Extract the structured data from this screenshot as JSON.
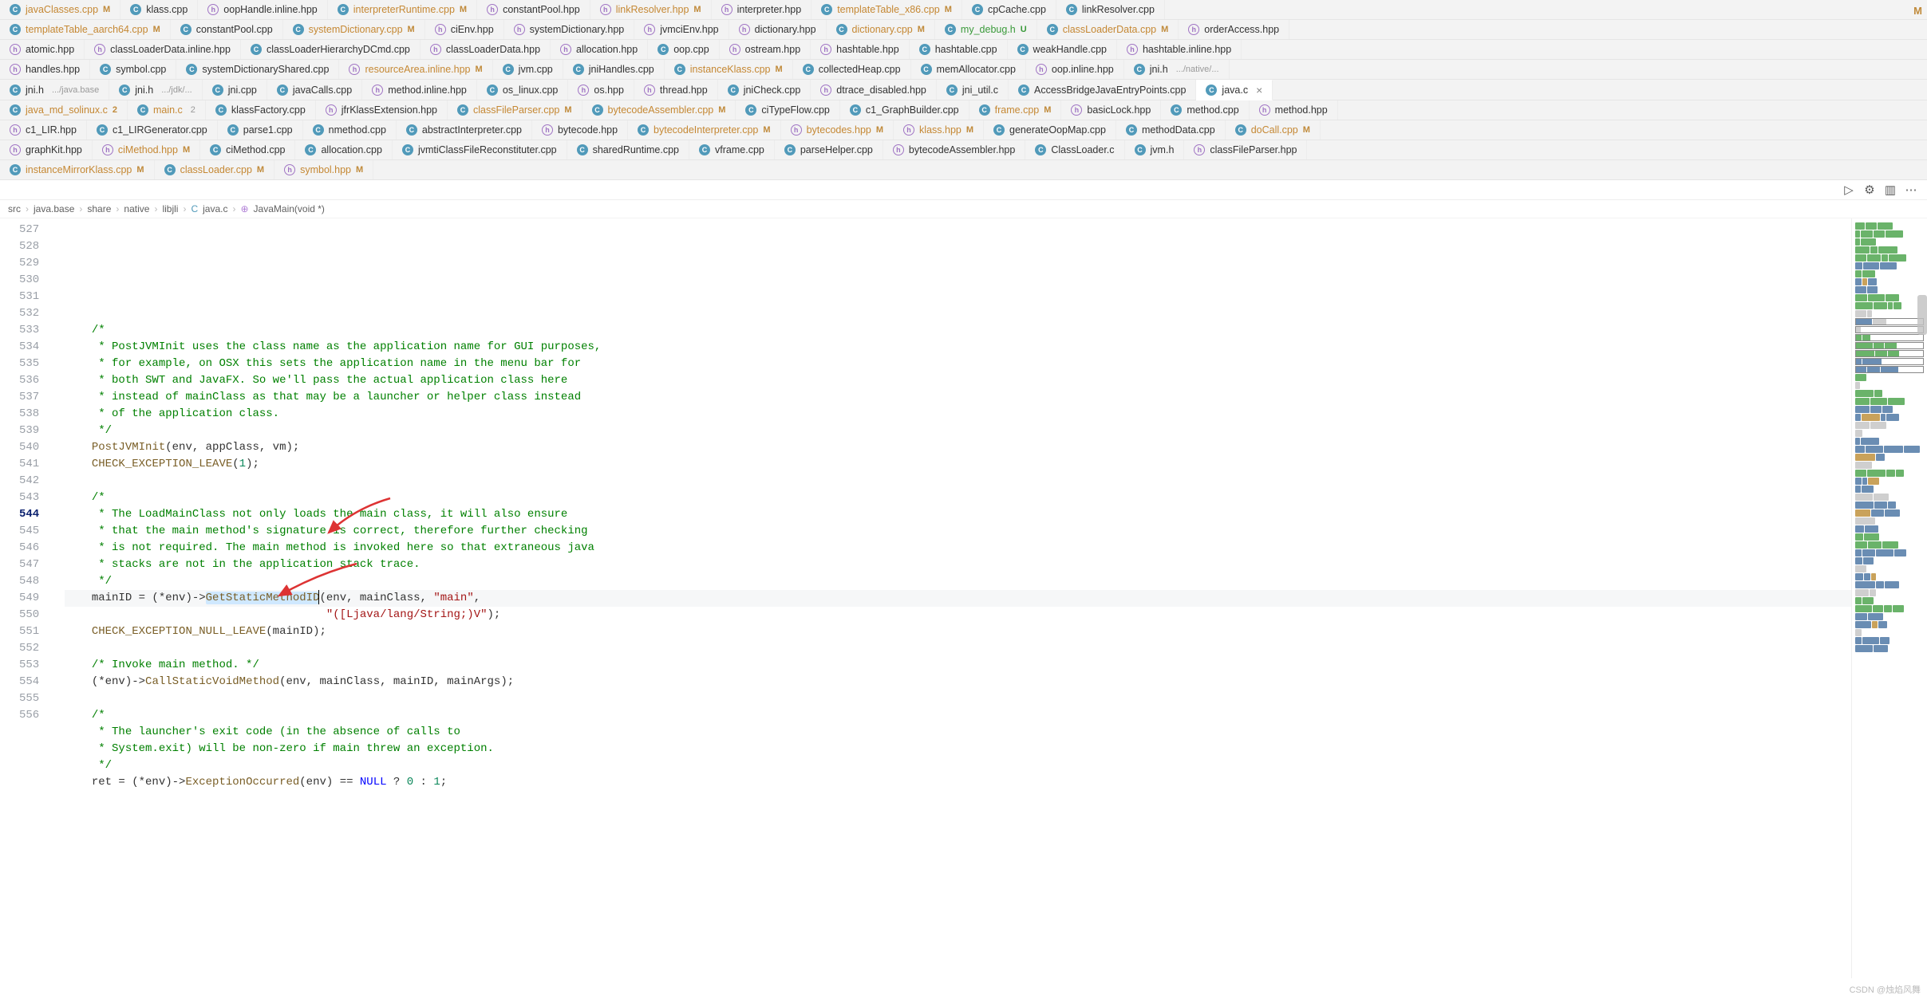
{
  "tab_rows": [
    [
      {
        "icon": "c",
        "name": "javaClasses.cpp",
        "mod": "M",
        "cls": "orange"
      },
      {
        "icon": "c",
        "name": "klass.cpp",
        "cls": "gray"
      },
      {
        "icon": "h",
        "name": "oopHandle.inline.hpp",
        "cls": "gray"
      },
      {
        "icon": "c",
        "name": "interpreterRuntime.cpp",
        "mod": "M",
        "cls": "orange"
      },
      {
        "icon": "h",
        "name": "constantPool.hpp",
        "cls": "gray"
      },
      {
        "icon": "h",
        "name": "linkResolver.hpp",
        "mod": "M",
        "cls": "orange"
      },
      {
        "icon": "h",
        "name": "interpreter.hpp",
        "cls": "gray"
      },
      {
        "icon": "c",
        "name": "templateTable_x86.cpp",
        "mod": "M",
        "cls": "orange"
      },
      {
        "icon": "c",
        "name": "cpCache.cpp",
        "cls": "gray"
      },
      {
        "icon": "c",
        "name": "linkResolver.cpp",
        "cls": "gray"
      }
    ],
    [
      {
        "icon": "c",
        "name": "templateTable_aarch64.cpp",
        "mod": "M",
        "cls": "orange"
      },
      {
        "icon": "c",
        "name": "constantPool.cpp",
        "cls": "gray"
      },
      {
        "icon": "c",
        "name": "systemDictionary.cpp",
        "mod": "M",
        "cls": "orange"
      },
      {
        "icon": "h",
        "name": "ciEnv.hpp",
        "cls": "gray"
      },
      {
        "icon": "h",
        "name": "systemDictionary.hpp",
        "cls": "gray"
      },
      {
        "icon": "h",
        "name": "jvmciEnv.hpp",
        "cls": "gray"
      },
      {
        "icon": "h",
        "name": "dictionary.hpp",
        "cls": "gray"
      },
      {
        "icon": "c",
        "name": "dictionary.cpp",
        "mod": "M",
        "cls": "orange"
      },
      {
        "icon": "c",
        "name": "my_debug.h",
        "mod": "U",
        "cls": "green"
      },
      {
        "icon": "c",
        "name": "classLoaderData.cpp",
        "mod": "M",
        "cls": "orange"
      },
      {
        "icon": "h",
        "name": "orderAccess.hpp",
        "cls": "gray"
      }
    ],
    [
      {
        "icon": "h",
        "name": "atomic.hpp",
        "cls": "gray"
      },
      {
        "icon": "h",
        "name": "classLoaderData.inline.hpp",
        "cls": "gray"
      },
      {
        "icon": "c",
        "name": "classLoaderHierarchyDCmd.cpp",
        "cls": "gray"
      },
      {
        "icon": "h",
        "name": "classLoaderData.hpp",
        "cls": "gray"
      },
      {
        "icon": "h",
        "name": "allocation.hpp",
        "cls": "gray"
      },
      {
        "icon": "c",
        "name": "oop.cpp",
        "cls": "gray"
      },
      {
        "icon": "h",
        "name": "ostream.hpp",
        "cls": "gray"
      },
      {
        "icon": "h",
        "name": "hashtable.hpp",
        "cls": "gray"
      },
      {
        "icon": "c",
        "name": "hashtable.cpp",
        "cls": "gray"
      },
      {
        "icon": "c",
        "name": "weakHandle.cpp",
        "cls": "gray"
      },
      {
        "icon": "h",
        "name": "hashtable.inline.hpp",
        "cls": "gray"
      }
    ],
    [
      {
        "icon": "h",
        "name": "handles.hpp",
        "cls": "gray"
      },
      {
        "icon": "c",
        "name": "symbol.cpp",
        "cls": "gray"
      },
      {
        "icon": "c",
        "name": "systemDictionaryShared.cpp",
        "cls": "gray"
      },
      {
        "icon": "h",
        "name": "resourceArea.inline.hpp",
        "mod": "M",
        "cls": "orange"
      },
      {
        "icon": "c",
        "name": "jvm.cpp",
        "cls": "gray"
      },
      {
        "icon": "c",
        "name": "jniHandles.cpp",
        "cls": "gray"
      },
      {
        "icon": "c",
        "name": "instanceKlass.cpp",
        "mod": "M",
        "cls": "orange"
      },
      {
        "icon": "c",
        "name": "collectedHeap.cpp",
        "cls": "gray"
      },
      {
        "icon": "c",
        "name": "memAllocator.cpp",
        "cls": "gray"
      },
      {
        "icon": "h",
        "name": "oop.inline.hpp",
        "cls": "gray"
      },
      {
        "icon": "c",
        "name": "jni.h",
        "sub": ".../native/...",
        "cls": "gray"
      }
    ],
    [
      {
        "icon": "c",
        "name": "jni.h",
        "sub": ".../java.base",
        "cls": "gray"
      },
      {
        "icon": "c",
        "name": "jni.h",
        "sub": ".../jdk/...",
        "cls": "gray"
      },
      {
        "icon": "c",
        "name": "jni.cpp",
        "cls": "gray"
      },
      {
        "icon": "c",
        "name": "javaCalls.cpp",
        "cls": "gray"
      },
      {
        "icon": "h",
        "name": "method.inline.hpp",
        "cls": "gray"
      },
      {
        "icon": "c",
        "name": "os_linux.cpp",
        "cls": "gray"
      },
      {
        "icon": "h",
        "name": "os.hpp",
        "cls": "gray"
      },
      {
        "icon": "h",
        "name": "thread.hpp",
        "cls": "gray"
      },
      {
        "icon": "c",
        "name": "jniCheck.cpp",
        "cls": "gray"
      },
      {
        "icon": "h",
        "name": "dtrace_disabled.hpp",
        "cls": "gray"
      },
      {
        "icon": "c",
        "name": "jni_util.c",
        "cls": "gray"
      },
      {
        "icon": "c",
        "name": "AccessBridgeJavaEntryPoints.cpp",
        "cls": "gray"
      },
      {
        "icon": "c",
        "name": "java.c",
        "cls": "gray",
        "active": true,
        "close": true
      }
    ],
    [
      {
        "icon": "c",
        "name": "java_md_solinux.c",
        "mod": "2",
        "cls": "orange"
      },
      {
        "icon": "c",
        "name": "main.c",
        "sub": "2",
        "cls": "orange"
      },
      {
        "icon": "c",
        "name": "klassFactory.cpp",
        "cls": "gray"
      },
      {
        "icon": "h",
        "name": "jfrKlassExtension.hpp",
        "cls": "gray"
      },
      {
        "icon": "c",
        "name": "classFileParser.cpp",
        "mod": "M",
        "cls": "orange"
      },
      {
        "icon": "c",
        "name": "bytecodeAssembler.cpp",
        "mod": "M",
        "cls": "orange"
      },
      {
        "icon": "c",
        "name": "ciTypeFlow.cpp",
        "cls": "gray"
      },
      {
        "icon": "c",
        "name": "c1_GraphBuilder.cpp",
        "cls": "gray"
      },
      {
        "icon": "c",
        "name": "frame.cpp",
        "mod": "M",
        "cls": "orange"
      },
      {
        "icon": "h",
        "name": "basicLock.hpp",
        "cls": "gray"
      },
      {
        "icon": "c",
        "name": "method.cpp",
        "cls": "gray"
      },
      {
        "icon": "h",
        "name": "method.hpp",
        "cls": "gray"
      }
    ],
    [
      {
        "icon": "h",
        "name": "c1_LIR.hpp",
        "cls": "gray"
      },
      {
        "icon": "c",
        "name": "c1_LIRGenerator.cpp",
        "cls": "gray"
      },
      {
        "icon": "c",
        "name": "parse1.cpp",
        "cls": "gray"
      },
      {
        "icon": "c",
        "name": "nmethod.cpp",
        "cls": "gray"
      },
      {
        "icon": "c",
        "name": "abstractInterpreter.cpp",
        "cls": "gray"
      },
      {
        "icon": "h",
        "name": "bytecode.hpp",
        "cls": "gray"
      },
      {
        "icon": "c",
        "name": "bytecodeInterpreter.cpp",
        "mod": "M",
        "cls": "orange"
      },
      {
        "icon": "h",
        "name": "bytecodes.hpp",
        "mod": "M",
        "cls": "orange"
      },
      {
        "icon": "h",
        "name": "klass.hpp",
        "mod": "M",
        "cls": "orange"
      },
      {
        "icon": "c",
        "name": "generateOopMap.cpp",
        "cls": "gray"
      },
      {
        "icon": "c",
        "name": "methodData.cpp",
        "cls": "gray"
      },
      {
        "icon": "c",
        "name": "doCall.cpp",
        "mod": "M",
        "cls": "orange"
      }
    ],
    [
      {
        "icon": "h",
        "name": "graphKit.hpp",
        "cls": "gray"
      },
      {
        "icon": "h",
        "name": "ciMethod.hpp",
        "mod": "M",
        "cls": "orange"
      },
      {
        "icon": "c",
        "name": "ciMethod.cpp",
        "cls": "gray"
      },
      {
        "icon": "c",
        "name": "allocation.cpp",
        "cls": "gray"
      },
      {
        "icon": "c",
        "name": "jvmtiClassFileReconstituter.cpp",
        "cls": "gray"
      },
      {
        "icon": "c",
        "name": "sharedRuntime.cpp",
        "cls": "gray"
      },
      {
        "icon": "c",
        "name": "vframe.cpp",
        "cls": "gray"
      },
      {
        "icon": "c",
        "name": "parseHelper.cpp",
        "cls": "gray"
      },
      {
        "icon": "h",
        "name": "bytecodeAssembler.hpp",
        "cls": "gray"
      },
      {
        "icon": "c",
        "name": "ClassLoader.c",
        "cls": "gray"
      },
      {
        "icon": "c",
        "name": "jvm.h",
        "cls": "gray"
      },
      {
        "icon": "h",
        "name": "classFileParser.hpp",
        "cls": "gray"
      }
    ],
    [
      {
        "icon": "c",
        "name": "instanceMirrorKlass.cpp",
        "mod": "M",
        "cls": "orange"
      },
      {
        "icon": "c",
        "name": "classLoader.cpp",
        "mod": "M",
        "cls": "orange"
      },
      {
        "icon": "h",
        "name": "symbol.hpp",
        "mod": "M",
        "cls": "orange"
      }
    ]
  ],
  "row_end_mod": {
    "0": "M"
  },
  "actionbar": {
    "run": "▷",
    "gear": "⚙",
    "split": "▥",
    "more": "⋯"
  },
  "breadcrumb": [
    "src",
    "java.base",
    "share",
    "native",
    "libjli",
    "java.c",
    "JavaMain(void *)"
  ],
  "breadcrumb_icons": {
    "file": "C",
    "symbol": "⊕"
  },
  "code": {
    "start": 527,
    "current": 544,
    "lines": [
      {
        "n": 527,
        "seg": []
      },
      {
        "n": 528,
        "seg": [
          {
            "t": "    ",
            "c": "pl"
          },
          {
            "t": "/*",
            "c": "c"
          }
        ]
      },
      {
        "n": 529,
        "seg": [
          {
            "t": "     * PostJVMInit uses the class name as the application name for GUI purposes,",
            "c": "c"
          }
        ]
      },
      {
        "n": 530,
        "seg": [
          {
            "t": "     * for example, on OSX this sets the application name in the menu bar for",
            "c": "c"
          }
        ]
      },
      {
        "n": 531,
        "seg": [
          {
            "t": "     * both SWT and JavaFX. So we'll pass the actual application class here",
            "c": "c"
          }
        ]
      },
      {
        "n": 532,
        "seg": [
          {
            "t": "     * instead of mainClass as that may be a launcher or helper class instead",
            "c": "c"
          }
        ]
      },
      {
        "n": 533,
        "seg": [
          {
            "t": "     * of the application class.",
            "c": "c"
          }
        ]
      },
      {
        "n": 534,
        "seg": [
          {
            "t": "     */",
            "c": "c"
          }
        ]
      },
      {
        "n": 535,
        "seg": [
          {
            "t": "    ",
            "c": "pl"
          },
          {
            "t": "PostJVMInit",
            "c": "fn"
          },
          {
            "t": "(env, appClass, vm);",
            "c": "pl"
          }
        ]
      },
      {
        "n": 536,
        "seg": [
          {
            "t": "    ",
            "c": "pl"
          },
          {
            "t": "CHECK_EXCEPTION_LEAVE",
            "c": "fn"
          },
          {
            "t": "(",
            "c": "pl"
          },
          {
            "t": "1",
            "c": "num"
          },
          {
            "t": ");",
            "c": "pl"
          }
        ]
      },
      {
        "n": 537,
        "seg": []
      },
      {
        "n": 538,
        "seg": [
          {
            "t": "    ",
            "c": "pl"
          },
          {
            "t": "/*",
            "c": "c"
          }
        ]
      },
      {
        "n": 539,
        "seg": [
          {
            "t": "     * The LoadMainClass not only loads the main class, it will also ensure",
            "c": "c"
          }
        ]
      },
      {
        "n": 540,
        "seg": [
          {
            "t": "     * that the main method's signature is correct, therefore further checking",
            "c": "c"
          }
        ]
      },
      {
        "n": 541,
        "seg": [
          {
            "t": "     * is not required. The main method is invoked here so that extraneous java",
            "c": "c"
          }
        ]
      },
      {
        "n": 542,
        "seg": [
          {
            "t": "     * stacks are not in the application stack trace.",
            "c": "c"
          }
        ]
      },
      {
        "n": 543,
        "seg": [
          {
            "t": "     */",
            "c": "c"
          }
        ]
      },
      {
        "n": 544,
        "cur": true,
        "seg": [
          {
            "t": "    mainID = (*env)->",
            "c": "pl"
          },
          {
            "t": "GetStaticMethodID",
            "c": "fn",
            "sel": true,
            "caret": true
          },
          {
            "t": "(env, mainClass, ",
            "c": "pl"
          },
          {
            "t": "\"main\"",
            "c": "str"
          },
          {
            "t": ",",
            "c": "pl"
          }
        ]
      },
      {
        "n": 545,
        "seg": [
          {
            "t": "                                       ",
            "c": "guides"
          },
          {
            "t": "\"([Ljava/lang/String;)V\"",
            "c": "str"
          },
          {
            "t": ");",
            "c": "pl"
          }
        ]
      },
      {
        "n": 546,
        "seg": [
          {
            "t": "    ",
            "c": "pl"
          },
          {
            "t": "CHECK_EXCEPTION_NULL_LEAVE",
            "c": "fn"
          },
          {
            "t": "(mainID);",
            "c": "pl"
          }
        ]
      },
      {
        "n": 547,
        "seg": []
      },
      {
        "n": 548,
        "seg": [
          {
            "t": "    ",
            "c": "pl"
          },
          {
            "t": "/* Invoke main method. */",
            "c": "c"
          }
        ]
      },
      {
        "n": 549,
        "seg": [
          {
            "t": "    (*env)->",
            "c": "pl"
          },
          {
            "t": "CallStaticVoidMethod",
            "c": "fn"
          },
          {
            "t": "(env, mainClass, mainID, mainArgs);",
            "c": "pl"
          }
        ]
      },
      {
        "n": 550,
        "seg": []
      },
      {
        "n": 551,
        "seg": [
          {
            "t": "    ",
            "c": "pl"
          },
          {
            "t": "/*",
            "c": "c"
          }
        ]
      },
      {
        "n": 552,
        "seg": [
          {
            "t": "     * The launcher's exit code (in the absence of calls to",
            "c": "c"
          }
        ]
      },
      {
        "n": 553,
        "seg": [
          {
            "t": "     * System.exit) will be non-zero if main threw an exception.",
            "c": "c"
          }
        ]
      },
      {
        "n": 554,
        "seg": [
          {
            "t": "     */",
            "c": "c"
          }
        ]
      },
      {
        "n": 555,
        "seg": [
          {
            "t": "    ret = (*env)->",
            "c": "pl"
          },
          {
            "t": "ExceptionOccurred",
            "c": "fn"
          },
          {
            "t": "(env) == ",
            "c": "pl"
          },
          {
            "t": "NULL",
            "c": "kw"
          },
          {
            "t": " ? ",
            "c": "pl"
          },
          {
            "t": "0",
            "c": "num"
          },
          {
            "t": " : ",
            "c": "pl"
          },
          {
            "t": "1",
            "c": "num"
          },
          {
            "t": ";",
            "c": "pl"
          }
        ]
      },
      {
        "n": 556,
        "seg": []
      }
    ]
  },
  "minimap": [
    [
      "g",
      "g",
      "g"
    ],
    [
      "g",
      "g",
      "g",
      "g"
    ],
    [
      "g",
      "g"
    ],
    [
      "g",
      "g",
      "g"
    ],
    [
      "g",
      "g",
      "g",
      "g"
    ],
    [
      "b",
      "b",
      "b"
    ],
    [
      "g",
      "g"
    ],
    [
      "b",
      "y",
      "b"
    ],
    [
      "b",
      "b"
    ],
    [
      "g",
      "g",
      "g"
    ],
    [
      "g",
      "g",
      "g",
      "g"
    ],
    [
      "x",
      "x"
    ],
    [
      "b",
      "x"
    ],
    [
      "x"
    ],
    [
      "g",
      "g"
    ],
    [
      "g",
      "g",
      "g"
    ],
    [
      "g",
      "g",
      "g"
    ],
    [
      "b",
      "b"
    ],
    [
      "b",
      "b",
      "b"
    ],
    [
      "g"
    ],
    [
      "x"
    ],
    [
      "g",
      "g"
    ],
    [
      "g",
      "g",
      "g"
    ],
    [
      "b",
      "b",
      "b"
    ],
    [
      "b",
      "y",
      "b",
      "b"
    ],
    [
      "x",
      "x"
    ],
    [
      "x"
    ],
    [
      "b",
      "b"
    ],
    [
      "b",
      "b",
      "b",
      "b"
    ],
    [
      "y",
      "b"
    ],
    [
      "x"
    ],
    [
      "g",
      "g",
      "g",
      "g"
    ],
    [
      "b",
      "b",
      "y"
    ],
    [
      "b",
      "b"
    ],
    [
      "x",
      "x"
    ],
    [
      "b",
      "b",
      "b"
    ],
    [
      "y",
      "b",
      "b"
    ],
    [
      "x"
    ],
    [
      "b",
      "b"
    ],
    [
      "g",
      "g"
    ],
    [
      "g",
      "g",
      "g"
    ],
    [
      "b",
      "b",
      "b",
      "b"
    ],
    [
      "b",
      "b"
    ],
    [
      "x"
    ],
    [
      "b",
      "b",
      "y"
    ],
    [
      "b",
      "b",
      "b"
    ],
    [
      "x",
      "x"
    ],
    [
      "g",
      "g"
    ],
    [
      "g",
      "g",
      "g",
      "g"
    ],
    [
      "b",
      "b"
    ],
    [
      "b",
      "y",
      "b"
    ],
    [
      "x"
    ],
    [
      "b",
      "b",
      "b"
    ],
    [
      "b",
      "b"
    ]
  ],
  "minimap_viewport": [
    12,
    18
  ],
  "watermark": "CSDN @烛焰风舞"
}
